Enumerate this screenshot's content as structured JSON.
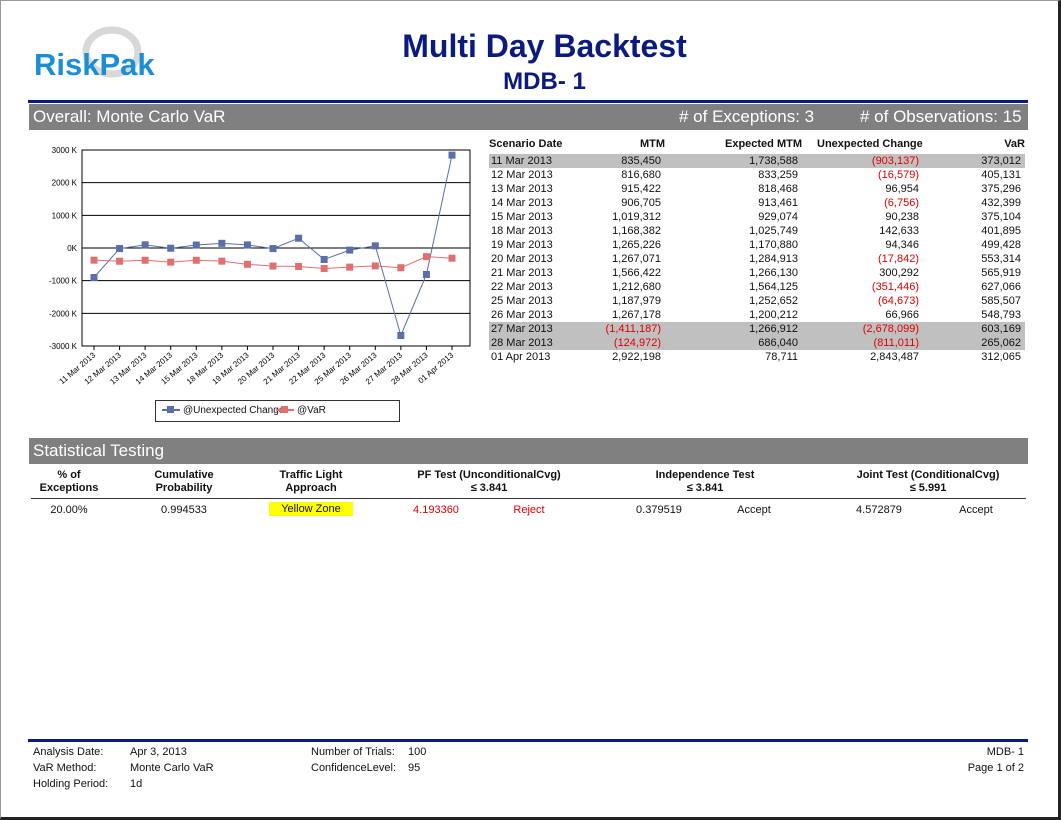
{
  "report": {
    "title": "Multi Day Backtest",
    "subtitle": "MDB- 1",
    "logo_text": "RiskPak",
    "colors": {
      "brand": "#0a1a7e",
      "logo": "#1a8fd6",
      "bar": "#808080",
      "negative": "#e00000",
      "highlight": "#c0c0c0",
      "yellow_zone": "#ffff00"
    }
  },
  "overall": {
    "label": "Overall:  Monte Carlo VaR",
    "exceptions": "# of Exceptions: 3",
    "observations": "# of Observations: 15"
  },
  "table": {
    "headers": [
      "Scenario Date",
      "MTM",
      "Expected MTM",
      "Unexpected Change",
      "VaR"
    ],
    "rows": [
      {
        "date": "11 Mar 2013",
        "mtm": "835,450",
        "exp": "1,738,588",
        "chg": "(903,137)",
        "var": "373,012",
        "mtm_neg": false,
        "chg_neg": true,
        "hl": true
      },
      {
        "date": "12 Mar 2013",
        "mtm": "816,680",
        "exp": "833,259",
        "chg": "(16,579)",
        "var": "405,131",
        "mtm_neg": false,
        "chg_neg": true,
        "hl": false
      },
      {
        "date": "13 Mar 2013",
        "mtm": "915,422",
        "exp": "818,468",
        "chg": "96,954",
        "var": "375,296",
        "mtm_neg": false,
        "chg_neg": false,
        "hl": false
      },
      {
        "date": "14 Mar 2013",
        "mtm": "906,705",
        "exp": "913,461",
        "chg": "(6,756)",
        "var": "432,399",
        "mtm_neg": false,
        "chg_neg": true,
        "hl": false
      },
      {
        "date": "15 Mar 2013",
        "mtm": "1,019,312",
        "exp": "929,074",
        "chg": "90,238",
        "var": "375,104",
        "mtm_neg": false,
        "chg_neg": false,
        "hl": false
      },
      {
        "date": "18 Mar 2013",
        "mtm": "1,168,382",
        "exp": "1,025,749",
        "chg": "142,633",
        "var": "401,895",
        "mtm_neg": false,
        "chg_neg": false,
        "hl": false
      },
      {
        "date": "19 Mar 2013",
        "mtm": "1,265,226",
        "exp": "1,170,880",
        "chg": "94,346",
        "var": "499,428",
        "mtm_neg": false,
        "chg_neg": false,
        "hl": false
      },
      {
        "date": "20 Mar 2013",
        "mtm": "1,267,071",
        "exp": "1,284,913",
        "chg": "(17,842)",
        "var": "553,314",
        "mtm_neg": false,
        "chg_neg": true,
        "hl": false
      },
      {
        "date": "21 Mar 2013",
        "mtm": "1,566,422",
        "exp": "1,266,130",
        "chg": "300,292",
        "var": "565,919",
        "mtm_neg": false,
        "chg_neg": false,
        "hl": false
      },
      {
        "date": "22 Mar 2013",
        "mtm": "1,212,680",
        "exp": "1,564,125",
        "chg": "(351,446)",
        "var": "627,066",
        "mtm_neg": false,
        "chg_neg": true,
        "hl": false
      },
      {
        "date": "25 Mar 2013",
        "mtm": "1,187,979",
        "exp": "1,252,652",
        "chg": "(64,673)",
        "var": "585,507",
        "mtm_neg": false,
        "chg_neg": true,
        "hl": false
      },
      {
        "date": "26 Mar 2013",
        "mtm": "1,267,178",
        "exp": "1,200,212",
        "chg": "66,966",
        "var": "548,793",
        "mtm_neg": false,
        "chg_neg": false,
        "hl": false
      },
      {
        "date": "27 Mar 2013",
        "mtm": "(1,411,187)",
        "exp": "1,266,912",
        "chg": "(2,678,099)",
        "var": "603,169",
        "mtm_neg": true,
        "chg_neg": true,
        "hl": true
      },
      {
        "date": "28 Mar 2013",
        "mtm": "(124,972)",
        "exp": "686,040",
        "chg": "(811,011)",
        "var": "265,062",
        "mtm_neg": true,
        "chg_neg": true,
        "hl": true
      },
      {
        "date": "01 Apr 2013",
        "mtm": "2,922,198",
        "exp": "78,711",
        "chg": "2,843,487",
        "var": "312,065",
        "mtm_neg": false,
        "chg_neg": false,
        "hl": false
      }
    ]
  },
  "chart_data": {
    "type": "line",
    "categories": [
      "11 Mar 2013",
      "12 Mar 2013",
      "13 Mar 2013",
      "14 Mar 2013",
      "15 Mar 2013",
      "18 Mar 2013",
      "19 Mar 2013",
      "20 Mar 2013",
      "21 Mar 2013",
      "22 Mar 2013",
      "25 Mar 2013",
      "26 Mar 2013",
      "27 Mar 2013",
      "28 Mar 2013",
      "01 Apr 2013"
    ],
    "series": [
      {
        "name": "@Unexpected Change",
        "color": "#5a6fa8",
        "marker": "square",
        "values": [
          -903137,
          -16579,
          96954,
          -6756,
          90238,
          142633,
          94346,
          -17842,
          300292,
          -351446,
          -64673,
          66966,
          -2678099,
          -811011,
          2843487
        ]
      },
      {
        "name": "@VaR",
        "color": "#e07070",
        "marker": "square",
        "values": [
          -373012,
          -405131,
          -375296,
          -432399,
          -375104,
          -401895,
          -499428,
          -553314,
          -565919,
          -627066,
          -585507,
          -548793,
          -603169,
          -265062,
          -312065
        ]
      }
    ],
    "ylim": [
      -3000000,
      3000000
    ],
    "yticks": [
      3000000,
      2000000,
      1000000,
      0,
      -1000000,
      -2000000,
      -3000000
    ],
    "ytick_labels": [
      "3000 K",
      "2000 K",
      "1000 K",
      "0K",
      "-1000 K",
      "-2000 K",
      "-3000 K"
    ],
    "grid": true,
    "legend": "bottom"
  },
  "stats": {
    "title": "Statistical Testing",
    "headers": {
      "pct": [
        "% of",
        "Exceptions"
      ],
      "cum": [
        "Cumulative",
        "Probability"
      ],
      "tl": [
        "Traffic Light",
        "Approach"
      ],
      "pf": [
        "PF Test (UnconditionalCvg)",
        "≤ 3.841"
      ],
      "ind": [
        "Independence Test",
        "≤ 3.841"
      ],
      "joint": [
        "Joint Test (ConditionalCvg)",
        "≤ 5.991"
      ]
    },
    "values": {
      "pct": "20.00%",
      "cum": "0.994533",
      "zone": "Yellow Zone",
      "pf": "4.193360",
      "pf_result": "Reject",
      "ind": "0.379519",
      "ind_result": "Accept",
      "joint": "4.572879",
      "joint_result": "Accept"
    }
  },
  "footer": {
    "analysis_date_label": "Analysis Date:",
    "analysis_date": "Apr 3, 2013",
    "var_method_label": "VaR Method:",
    "var_method": "Monte Carlo VaR",
    "holding_period_label": "Holding Period:",
    "holding_period": "1d",
    "trials_label": "Number of Trials:",
    "trials": "100",
    "confidence_label": "ConfidenceLevel:",
    "confidence": "95",
    "report_id": "MDB- 1",
    "page": "Page 1 of 2"
  }
}
